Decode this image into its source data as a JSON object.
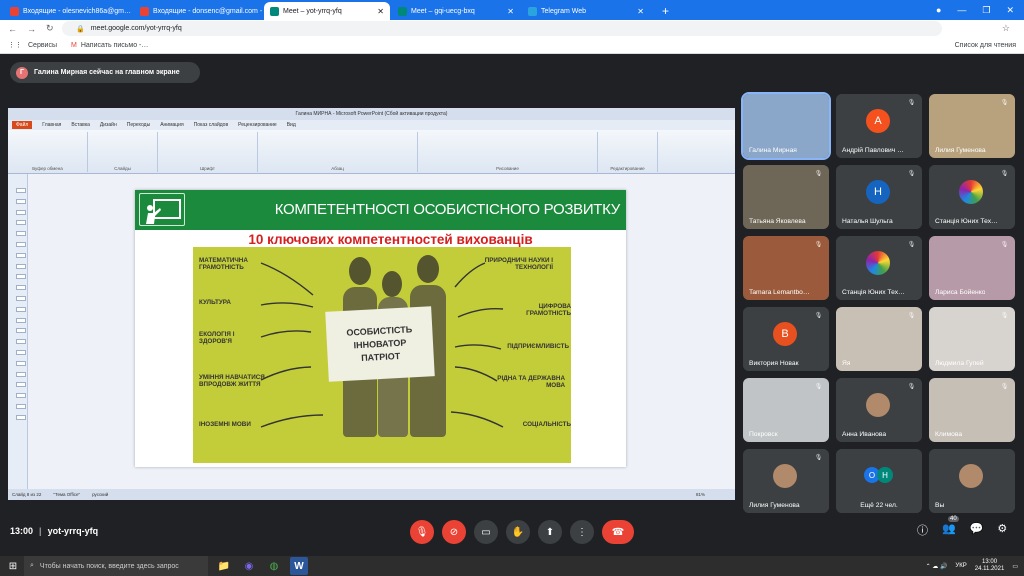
{
  "browser": {
    "tabs": [
      {
        "label": "Входящие - olesnevich86a@gm…",
        "favicon_color": "#ea4335",
        "active": false
      },
      {
        "label": "Входящие - donsenc@gmail.com - G…",
        "favicon_color": "#ea4335",
        "active": false
      },
      {
        "label": "Meet – yot-yrrq-yfq",
        "favicon_color": "#00897b",
        "active": true
      },
      {
        "label": "Meet – gqi-uecg-bxq",
        "favicon_color": "#00897b",
        "active": false
      },
      {
        "label": "Telegram Web",
        "favicon_color": "#2aa3df",
        "active": false
      }
    ],
    "url": "meet.google.com/yot-yrrq-yfq",
    "bookmarks": [
      "Сервисы",
      "Написать письмо -…"
    ],
    "reading_list": "Список для чтения"
  },
  "meet": {
    "presenting_notice": "Галина Мирная сейчас на главном экране",
    "presenter_initial": "Г",
    "time": "13:00",
    "code": "yot-yrrq-yfq",
    "participant_count": "40"
  },
  "ppt": {
    "title": "Галина МИРНА - Microsoft PowerPoint (Сбой активации продукта)",
    "menu": [
      "Файл",
      "Главная",
      "Вставка",
      "Дизайн",
      "Переходы",
      "Анимация",
      "Показ слайдов",
      "Рецензирование",
      "Вид"
    ],
    "groups": [
      "Буфер обмена",
      "Слайды",
      "Шрифт",
      "Абзац",
      "Рисование",
      "Редактирование"
    ],
    "status": [
      "Слайд 8 из 22",
      "\"Тема Office\"",
      "русский"
    ],
    "zoom": "81%"
  },
  "slide": {
    "title": "КОМПЕТЕНТНОСТІ ОСОБИСТІСНОГО РОЗВИТКУ",
    "subtitle": "10 ключових компетентностей вихованців",
    "sign": [
      "ОСОБИСТІСТЬ",
      "ІННОВАТОР",
      "ПАТРІОТ"
    ],
    "left_labels": [
      "МАТЕМАТИЧНА ГРАМОТНІСТЬ",
      "КУЛЬТУРА",
      "ЕКОЛОГІЯ І ЗДОРОВ'Я",
      "УМІННЯ НАВЧАТИСЯ ВПРОДОВЖ ЖИТТЯ",
      "ІНОЗЕМНІ МОВИ"
    ],
    "right_labels": [
      "ПРИРОДНИЧІ НАУКИ І ТЕХНОЛОГІЇ",
      "ЦИФРОВА ГРАМОТНІСТЬ",
      "ПІДПРИЄМЛИВІСТЬ",
      "РІДНА ТА ДЕРЖАВНА МОВА",
      "СОЦІАЛЬНІСТЬ"
    ]
  },
  "participants": [
    {
      "name": "Галина Мирная",
      "initial": "",
      "color": "#8aa6c8",
      "speaking": true
    },
    {
      "name": "Андрій Павлович …",
      "initial": "А",
      "color": "#f4511e"
    },
    {
      "name": "Лилия Гуменова",
      "initial": "",
      "color": "#b8a27e"
    },
    {
      "name": "Татьяна Яковлева",
      "initial": "",
      "color": "#6e6656"
    },
    {
      "name": "Наталья Шульга",
      "initial": "Н",
      "color": "#1565c0"
    },
    {
      "name": "Станція Юних Тех…",
      "initial": "",
      "color": "#3c4043",
      "logo": true
    },
    {
      "name": "Tamara Lemantbo…",
      "initial": "",
      "color": "#9c5a3c"
    },
    {
      "name": "Станція Юних Тех…",
      "initial": "",
      "color": "#3c4043",
      "logo": true
    },
    {
      "name": "Лариса Бойенко",
      "initial": "",
      "color": "#b79aa8"
    },
    {
      "name": "Виктория Новак",
      "initial": "В",
      "color": "#e8501f"
    },
    {
      "name": "Яя",
      "initial": "",
      "color": "#c8bfb5"
    },
    {
      "name": "Людмила Гупей",
      "initial": "",
      "color": "#d7d4d0"
    },
    {
      "name": "Покровск",
      "initial": "",
      "color": "#c0c4c6"
    },
    {
      "name": "Анна Иванова",
      "initial": "",
      "color": "#3c4043",
      "photo": true
    },
    {
      "name": "Климова",
      "initial": "",
      "color": "#c6bfb6"
    },
    {
      "name": "Лилия Гуменова",
      "initial": "",
      "color": "#3c4043",
      "photo": true
    },
    {
      "name": "Ещё 22 чел.",
      "initial": "",
      "color": "#3c4043",
      "more": [
        "О",
        "Н"
      ]
    },
    {
      "name": "Вы",
      "initial": "",
      "color": "#3c4043",
      "photo": true
    }
  ],
  "taskbar": {
    "search_placeholder": "Чтобы начать поиск, введите здесь запрос",
    "lang": "УКР",
    "time": "13:00",
    "date": "24.11.2021"
  }
}
